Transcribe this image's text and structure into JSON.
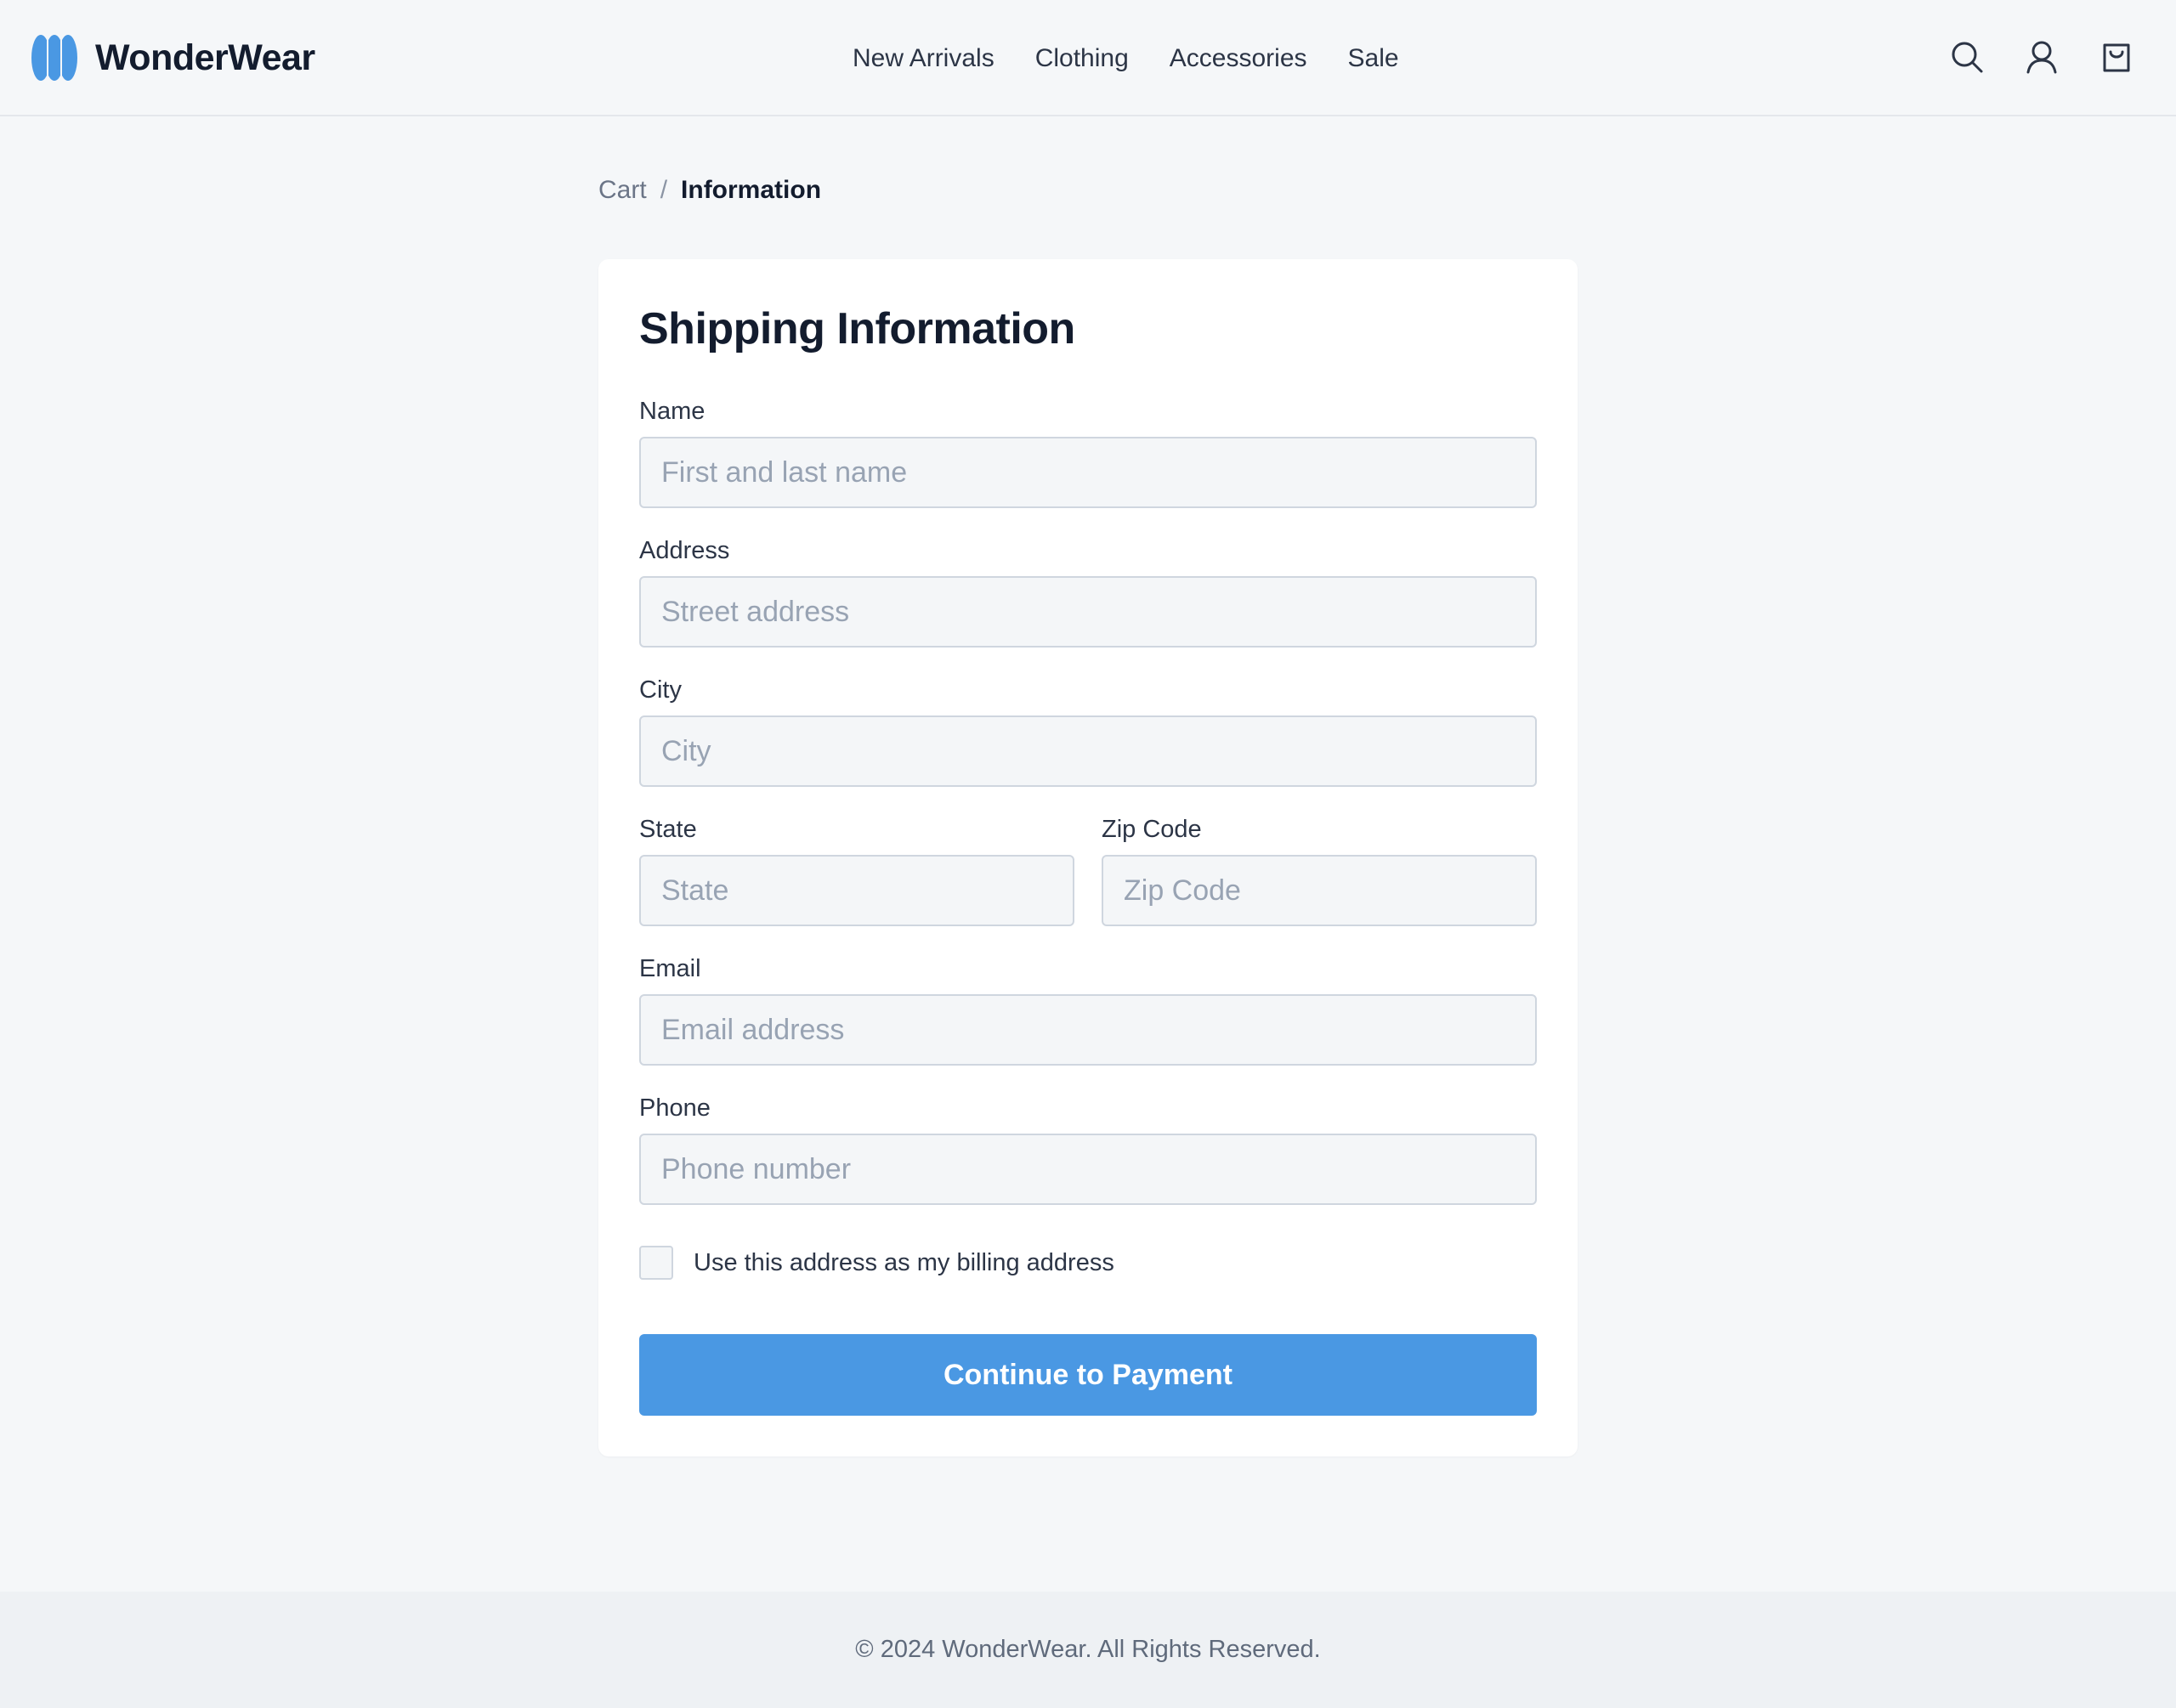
{
  "brand": {
    "name": "WonderWear",
    "logo_icon": "wonderwear-logo-icon",
    "accent_color": "#4a98e3"
  },
  "nav": {
    "items": [
      {
        "label": "New Arrivals"
      },
      {
        "label": "Clothing"
      },
      {
        "label": "Accessories"
      },
      {
        "label": "Sale"
      }
    ]
  },
  "header_icons": [
    "search-icon",
    "user-icon",
    "shopping-bag-icon"
  ],
  "breadcrumb": {
    "parent": "Cart",
    "separator": "/",
    "current": "Information"
  },
  "form": {
    "title": "Shipping Information",
    "fields": {
      "name": {
        "label": "Name",
        "placeholder": "First and last name",
        "value": ""
      },
      "address": {
        "label": "Address",
        "placeholder": "Street address",
        "value": ""
      },
      "city": {
        "label": "City",
        "placeholder": "City",
        "value": ""
      },
      "state": {
        "label": "State",
        "placeholder": "State",
        "value": ""
      },
      "zip": {
        "label": "Zip Code",
        "placeholder": "Zip Code",
        "value": ""
      },
      "email": {
        "label": "Email",
        "placeholder": "Email address",
        "value": ""
      },
      "phone": {
        "label": "Phone",
        "placeholder": "Phone number",
        "value": ""
      }
    },
    "billing_checkbox": {
      "label": "Use this address as my billing address",
      "checked": false
    },
    "submit_label": "Continue to Payment"
  },
  "footer": {
    "text": "© 2024 WonderWear. All Rights Reserved."
  }
}
